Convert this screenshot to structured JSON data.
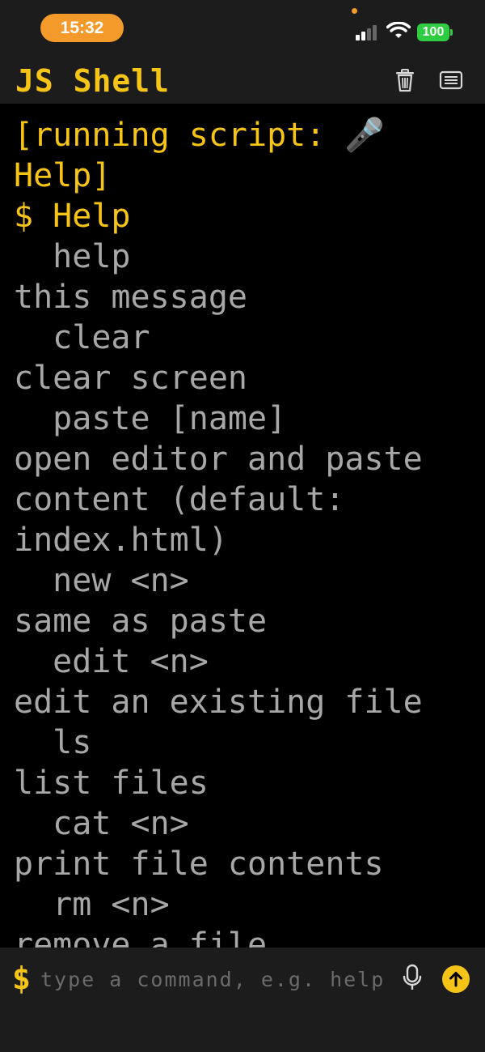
{
  "status_bar": {
    "time": "15:32",
    "battery": "100",
    "colors": {
      "time_pill": "#f39a2b",
      "battery": "#2ecc40"
    },
    "icons": [
      "signal-icon",
      "wifi-icon",
      "battery-icon"
    ]
  },
  "header": {
    "title": "JS Shell",
    "icons": [
      "trash-icon",
      "list-icon"
    ]
  },
  "terminal": {
    "lines": [
      "[running script: 🎤",
      "Help]",
      "$ Help",
      "  help",
      "this message",
      "  clear",
      "clear screen",
      "  paste [name]",
      "open editor and paste",
      "content (default:",
      "index.html)",
      "  new <n>",
      "same as paste",
      "  edit <n>",
      "edit an existing file",
      "  ls",
      "list files",
      "  cat <n>",
      "print file contents",
      "  rm <n>",
      "remove a file"
    ]
  },
  "input_bar": {
    "prompt": "$",
    "placeholder": "type a command, e.g. help",
    "value": "",
    "icons": [
      "microphone-icon",
      "send-arrow-icon"
    ]
  },
  "colors": {
    "accent": "#f6c416",
    "output_text": "#a7a7a7",
    "background": "#000000",
    "bar": "#1c1c1c"
  }
}
